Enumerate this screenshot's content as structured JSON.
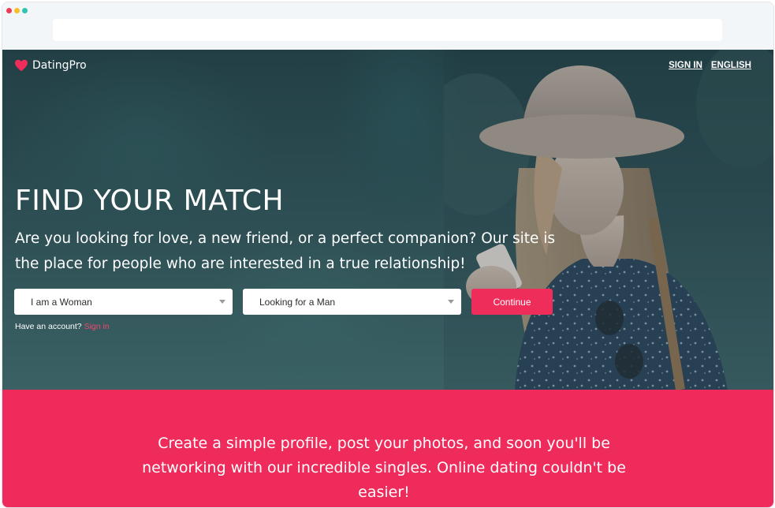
{
  "browser": {
    "url": ""
  },
  "brand": {
    "name": "DatingPro",
    "accent_color": "#ee2d5b"
  },
  "nav": {
    "sign_in": "SIGN IN",
    "language": "ENGLISH"
  },
  "hero": {
    "title": "FIND YOUR MATCH",
    "subtitle": "Are you looking for love, a new friend, or a perfect companion? Our site is the place for people who are interested in a true relationship!"
  },
  "form": {
    "gender_value": "I am a Woman",
    "seeking_value": "Looking for a Man",
    "continue_label": "Continue",
    "account_prompt": "Have an account?",
    "sign_in_link": "Sign in"
  },
  "band": {
    "text": "Create a simple profile, post your photos, and soon you'll be networking with our incredible singles. Online dating couldn't be easier!",
    "color": "#ef2b5b"
  },
  "icons": {
    "logo": "heart-icon",
    "dropdown": "chevron-down-icon"
  }
}
